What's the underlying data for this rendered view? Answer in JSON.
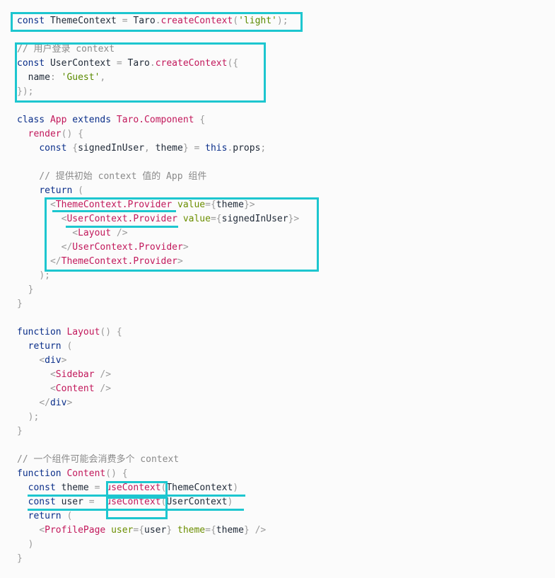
{
  "code_lines": [
    [
      [
        "kw",
        "const"
      ],
      [
        "plain",
        " ThemeContext "
      ],
      [
        "punc",
        "="
      ],
      [
        "plain",
        " Taro"
      ],
      [
        "punc",
        "."
      ],
      [
        "fn",
        "createContext"
      ],
      [
        "punc",
        "("
      ],
      [
        "str",
        "'light'"
      ],
      [
        "punc",
        ");"
      ]
    ],
    [],
    [
      [
        "comment",
        "// 用户登录 context"
      ]
    ],
    [
      [
        "kw",
        "const"
      ],
      [
        "plain",
        " UserContext "
      ],
      [
        "punc",
        "="
      ],
      [
        "plain",
        " Taro"
      ],
      [
        "punc",
        "."
      ],
      [
        "fn",
        "createContext"
      ],
      [
        "punc",
        "({"
      ]
    ],
    [
      [
        "plain",
        "  name"
      ],
      [
        "punc",
        ":"
      ],
      [
        "plain",
        " "
      ],
      [
        "str",
        "'Guest'"
      ],
      [
        "punc",
        ","
      ]
    ],
    [
      [
        "punc",
        "});"
      ]
    ],
    [],
    [
      [
        "kw",
        "class"
      ],
      [
        "plain",
        " "
      ],
      [
        "cls",
        "App"
      ],
      [
        "plain",
        " "
      ],
      [
        "kw",
        "extends"
      ],
      [
        "plain",
        " "
      ],
      [
        "cls",
        "Taro.Component"
      ],
      [
        "plain",
        " "
      ],
      [
        "punc",
        "{"
      ]
    ],
    [
      [
        "plain",
        "  "
      ],
      [
        "fn",
        "render"
      ],
      [
        "punc",
        "() {"
      ]
    ],
    [
      [
        "plain",
        "    "
      ],
      [
        "kw",
        "const"
      ],
      [
        "plain",
        " "
      ],
      [
        "punc",
        "{"
      ],
      [
        "plain",
        "signedInUser"
      ],
      [
        "punc",
        ","
      ],
      [
        "plain",
        " theme"
      ],
      [
        "punc",
        "}"
      ],
      [
        "plain",
        " "
      ],
      [
        "punc",
        "="
      ],
      [
        "plain",
        " "
      ],
      [
        "this",
        "this"
      ],
      [
        "punc",
        "."
      ],
      [
        "plain",
        "props"
      ],
      [
        "punc",
        ";"
      ]
    ],
    [],
    [
      [
        "comment",
        "    // 提供初始 context 值的 App 组件"
      ]
    ],
    [
      [
        "plain",
        "    "
      ],
      [
        "kw",
        "return"
      ],
      [
        "plain",
        " "
      ],
      [
        "punc",
        "("
      ]
    ],
    [
      [
        "plain",
        "      "
      ],
      [
        "punc",
        "<"
      ],
      [
        "tag",
        "ThemeContext.Provider"
      ],
      [
        "plain",
        " "
      ],
      [
        "attr",
        "value"
      ],
      [
        "punc",
        "={"
      ],
      [
        "plain",
        "theme"
      ],
      [
        "punc",
        "}>"
      ]
    ],
    [
      [
        "plain",
        "        "
      ],
      [
        "punc",
        "<"
      ],
      [
        "tag",
        "UserContext.Provider"
      ],
      [
        "plain",
        " "
      ],
      [
        "attr",
        "value"
      ],
      [
        "punc",
        "={"
      ],
      [
        "plain",
        "signedInUser"
      ],
      [
        "punc",
        "}>"
      ]
    ],
    [
      [
        "plain",
        "          "
      ],
      [
        "punc",
        "<"
      ],
      [
        "tag",
        "Layout"
      ],
      [
        "plain",
        " "
      ],
      [
        "punc",
        "/>"
      ]
    ],
    [
      [
        "plain",
        "        "
      ],
      [
        "punc",
        "</"
      ],
      [
        "tag",
        "UserContext.Provider"
      ],
      [
        "punc",
        ">"
      ]
    ],
    [
      [
        "plain",
        "      "
      ],
      [
        "punc",
        "</"
      ],
      [
        "tag",
        "ThemeContext.Provider"
      ],
      [
        "punc",
        ">"
      ]
    ],
    [
      [
        "plain",
        "    "
      ],
      [
        "punc",
        ");"
      ]
    ],
    [
      [
        "plain",
        "  "
      ],
      [
        "punc",
        "}"
      ]
    ],
    [
      [
        "punc",
        "}"
      ]
    ],
    [],
    [
      [
        "kw",
        "function"
      ],
      [
        "plain",
        " "
      ],
      [
        "fn",
        "Layout"
      ],
      [
        "punc",
        "() {"
      ]
    ],
    [
      [
        "plain",
        "  "
      ],
      [
        "kw",
        "return"
      ],
      [
        "plain",
        " "
      ],
      [
        "punc",
        "("
      ]
    ],
    [
      [
        "plain",
        "    "
      ],
      [
        "punc",
        "<"
      ],
      [
        "kw",
        "div"
      ],
      [
        "punc",
        ">"
      ]
    ],
    [
      [
        "plain",
        "      "
      ],
      [
        "punc",
        "<"
      ],
      [
        "tag",
        "Sidebar"
      ],
      [
        "plain",
        " "
      ],
      [
        "punc",
        "/>"
      ]
    ],
    [
      [
        "plain",
        "      "
      ],
      [
        "punc",
        "<"
      ],
      [
        "tag",
        "Content"
      ],
      [
        "plain",
        " "
      ],
      [
        "punc",
        "/>"
      ]
    ],
    [
      [
        "plain",
        "    "
      ],
      [
        "punc",
        "</"
      ],
      [
        "kw",
        "div"
      ],
      [
        "punc",
        ">"
      ]
    ],
    [
      [
        "plain",
        "  "
      ],
      [
        "punc",
        ");"
      ]
    ],
    [
      [
        "punc",
        "}"
      ]
    ],
    [],
    [
      [
        "comment",
        "// 一个组件可能会消费多个 context"
      ]
    ],
    [
      [
        "kw",
        "function"
      ],
      [
        "plain",
        " "
      ],
      [
        "fn",
        "Content"
      ],
      [
        "punc",
        "() {"
      ]
    ],
    [
      [
        "plain",
        "  "
      ],
      [
        "kw",
        "const"
      ],
      [
        "plain",
        " theme "
      ],
      [
        "punc",
        "="
      ],
      [
        "plain",
        " "
      ],
      [
        "fn",
        "useContext"
      ],
      [
        "punc",
        "("
      ],
      [
        "plain",
        "ThemeContext"
      ],
      [
        "punc",
        ")"
      ]
    ],
    [
      [
        "plain",
        "  "
      ],
      [
        "kw",
        "const"
      ],
      [
        "plain",
        " user "
      ],
      [
        "punc",
        "="
      ],
      [
        "plain",
        "  "
      ],
      [
        "fn",
        "useContext"
      ],
      [
        "punc",
        "("
      ],
      [
        "plain",
        "UserContext"
      ],
      [
        "punc",
        ")"
      ]
    ],
    [
      [
        "plain",
        "  "
      ],
      [
        "kw",
        "return"
      ],
      [
        "plain",
        " "
      ],
      [
        "punc",
        "("
      ]
    ],
    [
      [
        "plain",
        "    "
      ],
      [
        "punc",
        "<"
      ],
      [
        "tag",
        "ProfilePage"
      ],
      [
        "plain",
        " "
      ],
      [
        "attr",
        "user"
      ],
      [
        "punc",
        "={"
      ],
      [
        "plain",
        "user"
      ],
      [
        "punc",
        "}"
      ],
      [
        "plain",
        " "
      ],
      [
        "attr",
        "theme"
      ],
      [
        "punc",
        "={"
      ],
      [
        "plain",
        "theme"
      ],
      [
        "punc",
        "}"
      ],
      [
        "plain",
        " "
      ],
      [
        "punc",
        "/>"
      ]
    ],
    [
      [
        "plain",
        "  "
      ],
      [
        "punc",
        ")"
      ]
    ],
    [
      [
        "punc",
        "}"
      ]
    ]
  ],
  "highlight_color": "#1dc6cf"
}
